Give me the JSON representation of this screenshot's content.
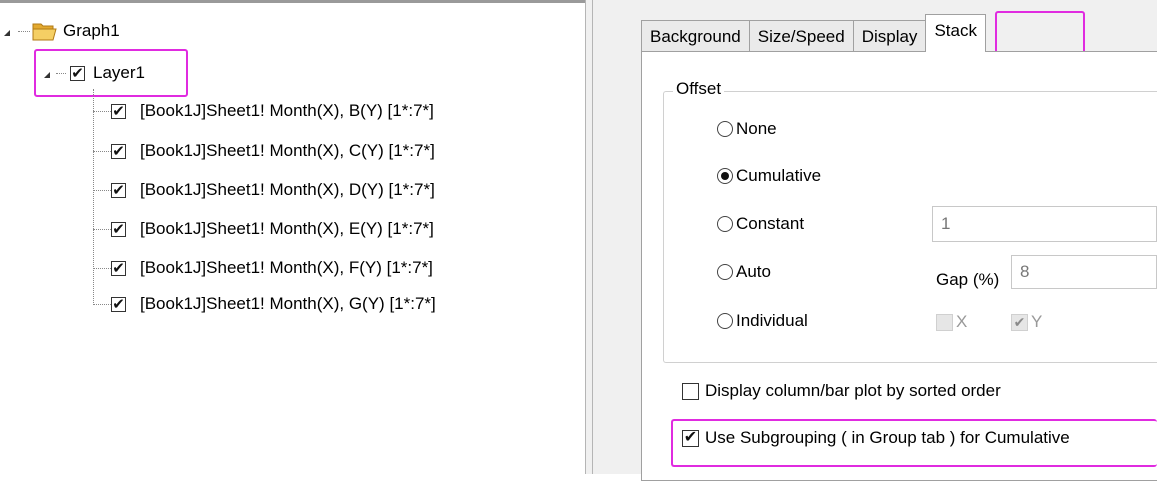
{
  "tree": {
    "root_label": "Graph1",
    "layer_label": "Layer1",
    "items": [
      {
        "label": "[Book1J]Sheet1! Month(X), B(Y) [1*:7*]",
        "checked": true
      },
      {
        "label": "[Book1J]Sheet1! Month(X), C(Y) [1*:7*]",
        "checked": true
      },
      {
        "label": "[Book1J]Sheet1! Month(X), D(Y) [1*:7*]",
        "checked": true
      },
      {
        "label": "[Book1J]Sheet1! Month(X), E(Y) [1*:7*]",
        "checked": true
      },
      {
        "label": "[Book1J]Sheet1! Month(X), F(Y) [1*:7*]",
        "checked": true
      },
      {
        "label": "[Book1J]Sheet1! Month(X), G(Y) [1*:7*]",
        "checked": true
      }
    ],
    "check_glyph": "✔"
  },
  "dialog": {
    "tabs": [
      "Background",
      "Size/Speed",
      "Display",
      "Stack"
    ],
    "active_tab": "Stack",
    "offset": {
      "title": "Offset",
      "options": [
        "None",
        "Cumulative",
        "Constant",
        "Auto",
        "Individual"
      ],
      "selected": "Cumulative",
      "constant_value": "1",
      "gap_label": "Gap (%)",
      "gap_value": "8",
      "x_label": "X",
      "y_label": "Y",
      "x_checked": false,
      "y_checked": true
    },
    "sorted_order_label": "Display column/bar plot by sorted order",
    "sorted_order_checked": false,
    "subgrouping_label": "Use Subgrouping ( in Group tab ) for Cumulative",
    "subgrouping_checked": true
  },
  "colors": {
    "highlight": "#e02be0",
    "folder": "#f2c14e"
  }
}
